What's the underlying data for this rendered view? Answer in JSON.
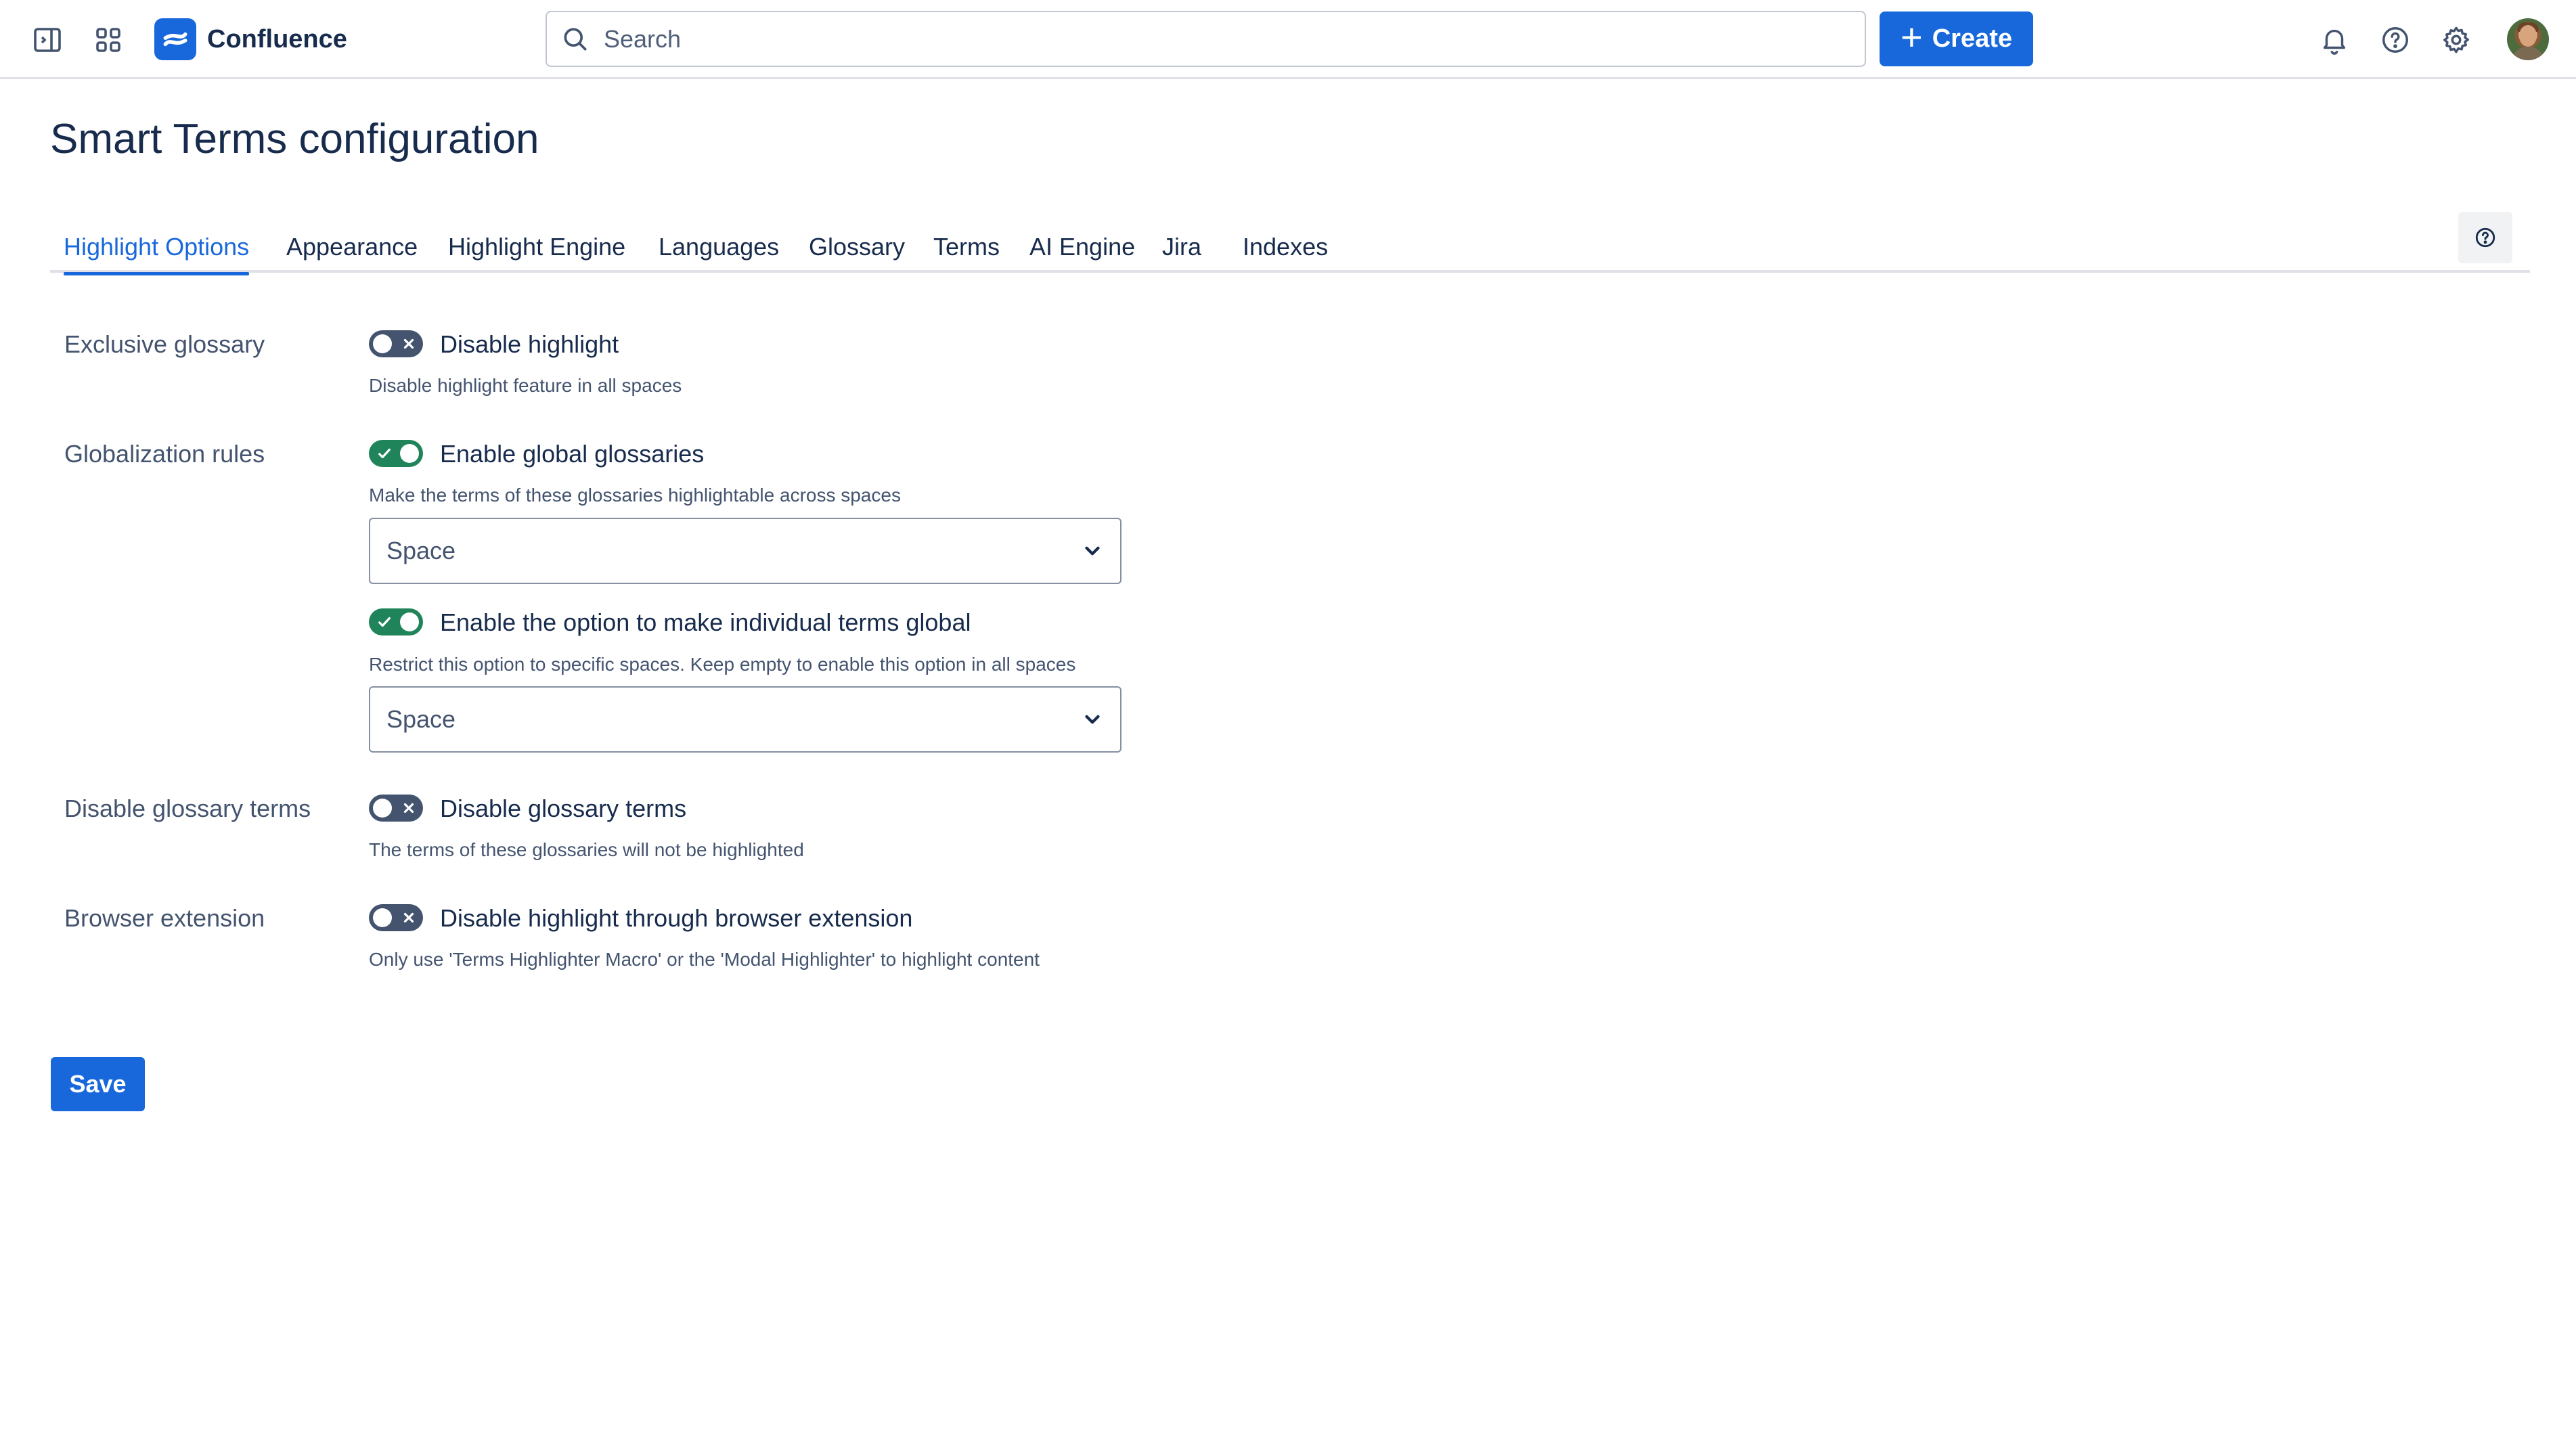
{
  "app": {
    "name": "Confluence",
    "brand_color": "#1868db"
  },
  "topnav": {
    "search_placeholder": "Search",
    "create_label": "Create",
    "icons": [
      "sidebar-toggle-icon",
      "app-switcher-icon",
      "confluence-logo-icon",
      "search-icon",
      "plus-icon",
      "bell-icon",
      "help-icon",
      "settings-icon",
      "avatar"
    ]
  },
  "page": {
    "title": "Smart Terms configuration"
  },
  "tabs": [
    {
      "label": "Highlight Options",
      "active": true
    },
    {
      "label": "Appearance",
      "active": false
    },
    {
      "label": "Highlight Engine",
      "active": false
    },
    {
      "label": "Languages",
      "active": false
    },
    {
      "label": "Glossary",
      "active": false
    },
    {
      "label": "Terms",
      "active": false
    },
    {
      "label": "AI Engine",
      "active": false
    },
    {
      "label": "Jira",
      "active": false
    },
    {
      "label": "Indexes",
      "active": false
    }
  ],
  "form": {
    "exclusive_glossary": {
      "label": "Exclusive glossary",
      "toggle_label": "Disable highlight",
      "toggle_on": false,
      "helper": "Disable highlight feature in all spaces"
    },
    "globalization_rules": {
      "label": "Globalization rules",
      "toggle_label": "Enable global glossaries",
      "toggle_on": true,
      "helper": "Make the terms of these glossaries highlightable across spaces",
      "select_value": "Space",
      "toggle2_label": "Enable the option to make individual terms global",
      "toggle2_on": true,
      "helper2": "Restrict this option to specific spaces. Keep empty to enable this option in all spaces",
      "select2_value": "Space"
    },
    "disable_glossary_terms": {
      "label": "Disable glossary terms",
      "toggle_label": "Disable glossary terms",
      "toggle_on": false,
      "helper": "The terms of these glossaries will not be highlighted"
    },
    "browser_extension": {
      "label": "Browser extension",
      "toggle_label": "Disable highlight through browser extension",
      "toggle_on": false,
      "helper": "Only use 'Terms Highlighter Macro' or the 'Modal Highlighter' to highlight content"
    }
  },
  "actions": {
    "save_label": "Save"
  }
}
